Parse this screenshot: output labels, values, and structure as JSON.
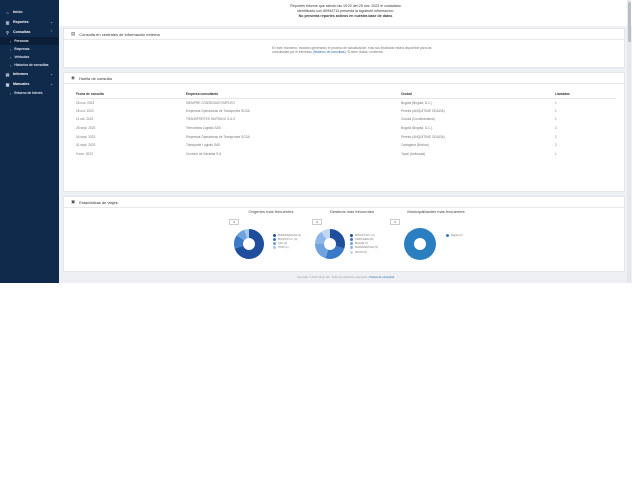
{
  "sidebar": {
    "items": [
      {
        "label": "Inicio",
        "icon": "home-icon"
      },
      {
        "label": "Reportes",
        "icon": "report-icon",
        "chevron": "⌄"
      },
      {
        "label": "Consultas",
        "icon": "search-icon",
        "chevron": "⌃"
      }
    ],
    "subitems": [
      {
        "label": "Personas",
        "active": true
      },
      {
        "label": "Empresas"
      },
      {
        "label": "Vehículos"
      },
      {
        "label": "Historico de consultas"
      }
    ],
    "items2": [
      {
        "label": "Informes",
        "icon": "document-icon",
        "chevron": "⌄"
      },
      {
        "label": "Manuales",
        "icon": "book-icon",
        "chevron": "⌄"
      }
    ],
    "extra": {
      "label": "Entorno de Interés"
    }
  },
  "top_message": {
    "line1": "Reportes informe que siendo las 19:22 del 25 nov. 2023 el ciudadano",
    "line2": "identificado con 80994714 presenta la siguiente información:",
    "line3": "No presenta reportes activos en nuestra base de datos"
  },
  "external": {
    "title": "Consulta en centrales de información externa",
    "text1": "En este momento, estamos generando el proceso de actualización, mas sus finalizado",
    "text2": "estará disponible para las consultadas por el interesdo",
    "link": "(histórico de consultas)",
    "text3": "Si tiene dudas, revisenos"
  },
  "trail": {
    "title": "Huella de consulta",
    "headers": [
      "Fecha de consulta",
      "Empresa consultante",
      "Ciudad",
      "Llamadas"
    ],
    "rows": [
      [
        "26 nov. 2023",
        "SIEMPRE CONSEGUIR EMPLEO",
        "Bogotá (Bogotá, D.C.)",
        "1"
      ],
      [
        "26 oct. 2023",
        "Empresas Operadoras de Transportes SCSA",
        "Pereira (ANQUÍTIME ODAZIA)",
        "1"
      ],
      [
        "11 oct. 2023",
        "TRANSPORTES HURTADO S.A.S",
        "Cúcuta (Cundinamarca)",
        "1"
      ],
      [
        "28 sept. 2023",
        "Termotrans Logistic SAS",
        "Bogotá (Bogotá, D.C.)",
        "2"
      ],
      [
        "04 sept. 2023",
        "Empresas Operadoras de Transportes SCSA",
        "Pereira (ANQUÍTIME ODAZIA)",
        "1"
      ],
      [
        "01 sept. 2023",
        "Transporte Logistic SAS",
        "Cartagena (Bolívar)",
        "2"
      ],
      [
        "9 ene. 2023",
        "Centurio de Sarabita S.A",
        "Yopal (Antioquia)",
        "1"
      ]
    ]
  },
  "stats": {
    "title": "Estadísticas de viajes",
    "badge": "4",
    "origins_title": "Orígenes más frecuentes",
    "destinations_title": "Destinos más frecuentes",
    "municipalities_title": "Municipalidades más frecuentes"
  },
  "chart_data": [
    {
      "type": "pie",
      "title": "Orígenes más frecuentes",
      "labels": [
        "BUENAVENTURA (V)",
        "BOGOTA D.C. (C)",
        "CALI (V)",
        "OTRA (C)"
      ],
      "values": [
        70,
        15,
        10,
        5
      ],
      "colors": [
        "#1f4f9c",
        "#3a78c8",
        "#6fa3e0",
        "#a9c8ee"
      ]
    },
    {
      "type": "pie",
      "title": "Destinos más frecuentes",
      "labels": [
        "BOGOTÁ D.C. (C)",
        "CARTAGENA (B)",
        "IBAGUE (T)",
        "BUENAVENTURA (V)",
        "PASTO (N)"
      ],
      "values": [
        30,
        25,
        20,
        15,
        10
      ],
      "colors": [
        "#1f4f9c",
        "#3a78c8",
        "#6fa3e0",
        "#8db6ea",
        "#c2d8f2"
      ]
    },
    {
      "type": "pie",
      "title": "Municipalidades más frecuentes",
      "labels": [
        "Bogotá (C)"
      ],
      "values": [
        100
      ],
      "colors": [
        "#2a7fc0"
      ]
    }
  ],
  "footer": {
    "text": "Copyright © 2023 Grupo SCI. Todos los derechos reservados |",
    "link": "Política de privacidad"
  }
}
